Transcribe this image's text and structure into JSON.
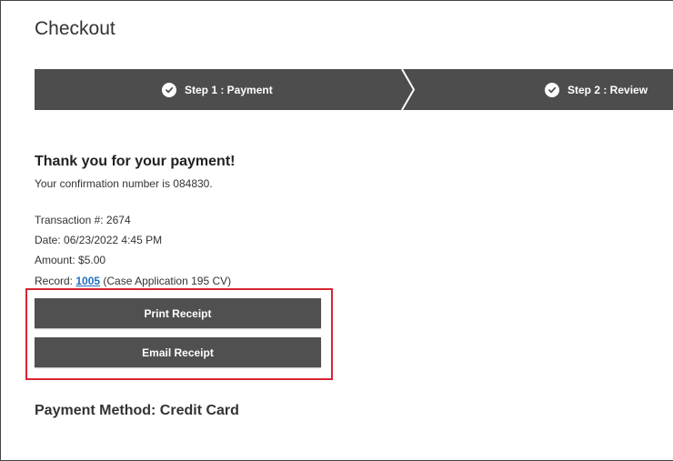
{
  "page": {
    "title": "Checkout"
  },
  "steps": [
    {
      "label": "Step 1 : Payment",
      "icon": "check-circle-icon"
    },
    {
      "label": "Step 2 : Review",
      "icon": "check-circle-icon"
    }
  ],
  "confirmation": {
    "heading": "Thank you for your payment!",
    "text": "Your confirmation number is 084830."
  },
  "details": {
    "transaction": "Transaction #: 2674",
    "date": "Date: 06/23/2022 4:45 PM",
    "amount": "Amount: $5.00",
    "record_prefix": "Record: ",
    "record_link": "1005",
    "record_suffix": " (Case Application 195 CV)"
  },
  "actions": {
    "print_label": "Print Receipt",
    "email_label": "Email Receipt"
  },
  "payment_method": {
    "heading": "Payment Method: Credit Card"
  },
  "colors": {
    "stepbar": "#4d4d4d",
    "button": "#505050",
    "highlight": "#d6262f",
    "link": "#1f6fbf"
  }
}
